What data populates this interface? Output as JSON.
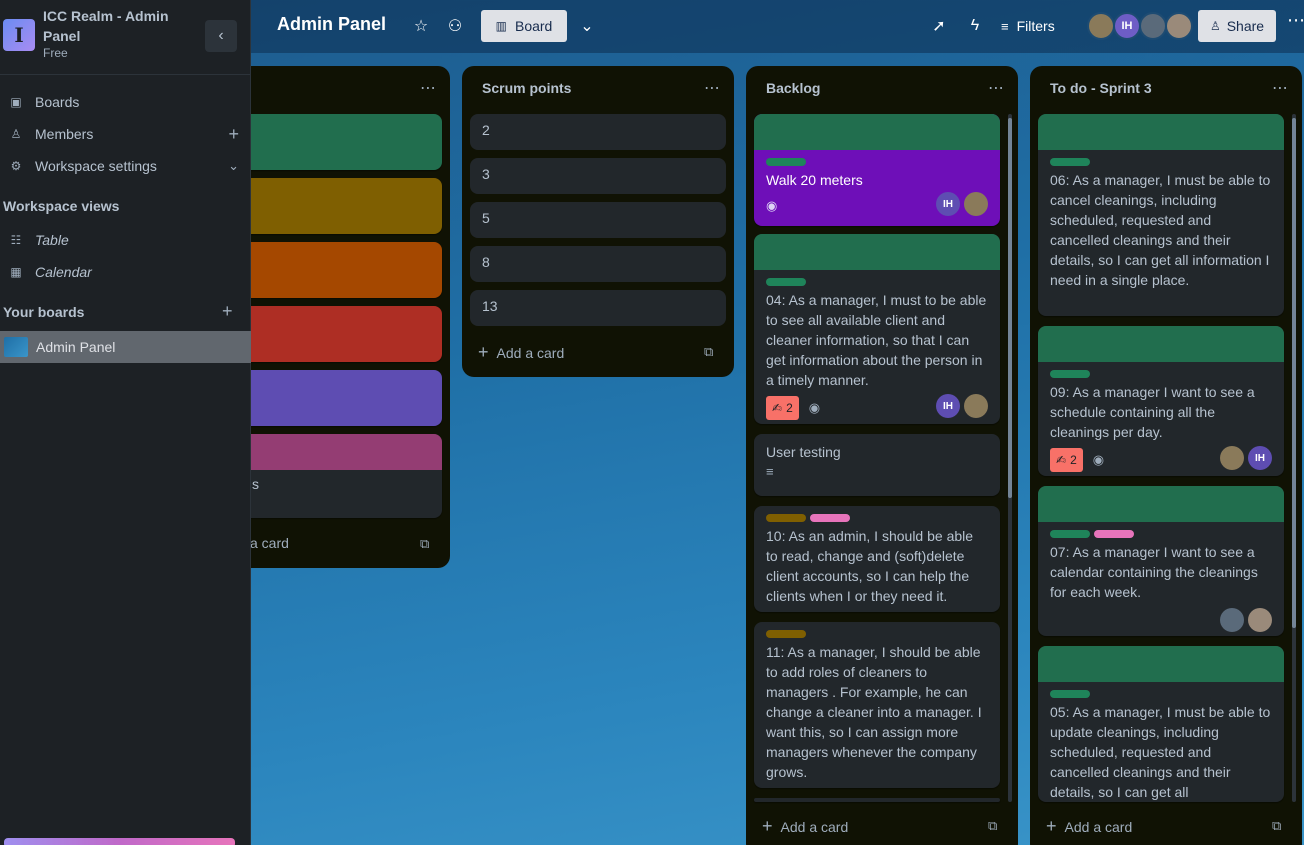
{
  "workspace": {
    "name": "ICC Realm - Admin Panel",
    "plan": "Free",
    "logo_letter": "I"
  },
  "sidebar": {
    "nav": [
      {
        "label": "Boards",
        "icon": "boards-icon"
      },
      {
        "label": "Members",
        "icon": "person-icon"
      },
      {
        "label": "Workspace settings",
        "icon": "gear-icon"
      }
    ],
    "views_title": "Workspace views",
    "views": [
      {
        "label": "Table",
        "icon": "table-icon"
      },
      {
        "label": "Calendar",
        "icon": "calendar-icon"
      }
    ],
    "boards_title": "Your boards",
    "boards": [
      {
        "label": "Admin Panel"
      }
    ]
  },
  "header": {
    "board_title": "Admin Panel",
    "view_label": "Board",
    "filters_label": "Filters",
    "share_label": "Share",
    "avatars": [
      {
        "initials": "",
        "color": "#8a7a5a"
      },
      {
        "initials": "IH",
        "color": "#6e5dc6"
      },
      {
        "initials": "",
        "color": "#5a6a7a"
      },
      {
        "initials": "",
        "color": "#9a8a7a"
      }
    ]
  },
  "lists": {
    "partial": {
      "tail_text": "s",
      "add_card": "a card",
      "covers": [
        "#216e4e",
        "#7f5f01",
        "#a54800",
        "#ae2e24",
        "#5e4db2",
        "#943d73"
      ]
    },
    "scrum": {
      "title": "Scrum points",
      "cards": [
        "2",
        "3",
        "5",
        "8",
        "13"
      ],
      "add_card": "Add a card"
    },
    "backlog": {
      "title": "Backlog",
      "add_card": "Add a card",
      "cards": [
        {
          "text": "Walk 20 meters"
        },
        {
          "text": "04: As a manager, I must to be able to see all available client and cleaner information, so that I can get information about the person in a timely manner.",
          "votes": "2"
        },
        {
          "text": "User testing"
        },
        {
          "text": "10: As an admin, I should be able to read, change and (soft)delete client accounts, so I can help the clients when I or they need it."
        },
        {
          "text": "11: As a manager, I should be able to add roles of cleaners to managers . For example, he can change a cleaner into a manager. I want this, so I can assign more managers whenever the company grows."
        }
      ],
      "member_initials": "IH"
    },
    "todo": {
      "title": "To do - Sprint 3",
      "add_card": "Add a card",
      "cards": [
        {
          "text": "06: As a manager, I must be able to cancel cleanings, including scheduled, requested and cancelled cleanings and their details, so I can get all information I need in a single place."
        },
        {
          "text": "09: As a manager I want to see a schedule containing all the cleanings per day.",
          "votes": "2"
        },
        {
          "text": "07: As a manager I want to see a calendar containing the cleanings for each week."
        },
        {
          "text": "05: As a manager, I must be able to update cleanings, including scheduled, requested and cancelled cleanings and their details, so I can get all"
        }
      ],
      "member_initials": "IH"
    }
  },
  "colors": {
    "green": "#216e4e",
    "purple": "#6e0fb8",
    "pink": "#e774bb",
    "mustard": "#7f5f01",
    "label_green": "#1f845a"
  }
}
